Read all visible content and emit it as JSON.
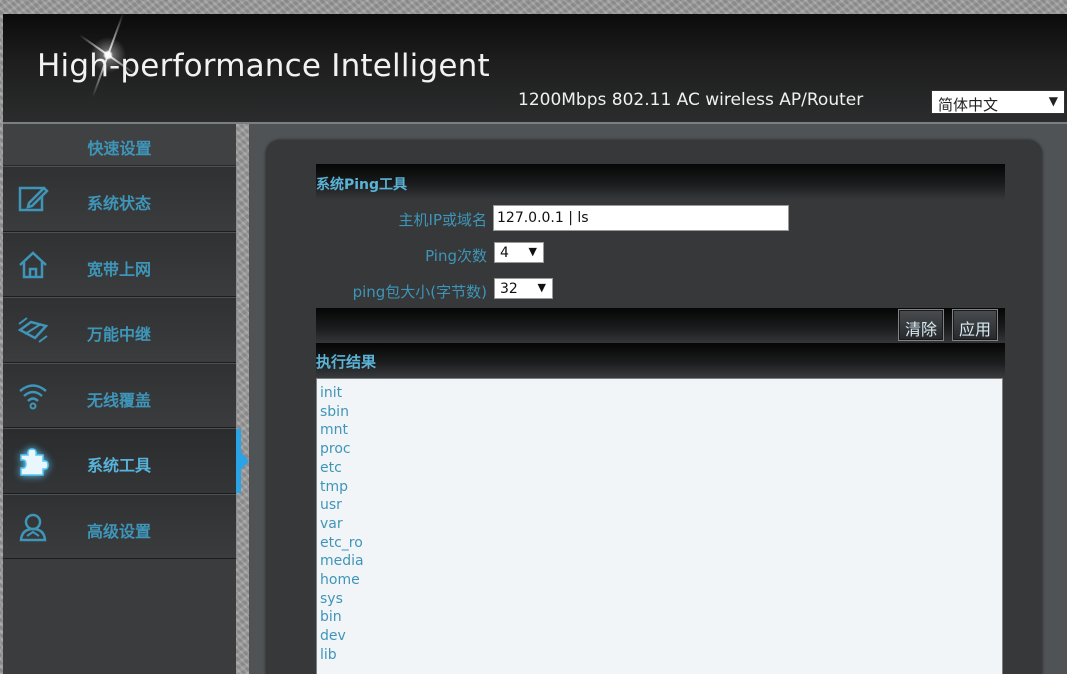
{
  "header": {
    "brand": "High-performance Intelligent",
    "subtitle": "1200Mbps 802.11 AC  wireless AP/Router",
    "language": "简体中文"
  },
  "sidebar": {
    "title": "快速设置",
    "items": [
      {
        "label": "系统状态",
        "icon": "edit-icon"
      },
      {
        "label": "宽带上网",
        "icon": "home-icon"
      },
      {
        "label": "万能中继",
        "icon": "repeater-icon"
      },
      {
        "label": "无线覆盖",
        "icon": "wifi-icon"
      },
      {
        "label": "系统工具",
        "icon": "puzzle-icon",
        "active": true
      },
      {
        "label": "高级设置",
        "icon": "user-icon"
      }
    ]
  },
  "ping_tool": {
    "title": "系统Ping工具",
    "host_label": "主机IP或域名",
    "host_value": "127.0.0.1 | ls",
    "count_label": "Ping次数",
    "count_value": "4",
    "size_label": "ping包大小(字节数)",
    "size_value": "32",
    "clear_label": "清除",
    "apply_label": "应用",
    "result_title": "执行结果",
    "result_lines": [
      "init",
      "sbin",
      "mnt",
      "proc",
      "etc",
      "tmp",
      "usr",
      "var",
      "etc_ro",
      "media",
      "home",
      "sys",
      "bin",
      "dev",
      "lib"
    ]
  },
  "colors": {
    "accent": "#3f95b8",
    "active_indicator": "#2aa4e6"
  }
}
